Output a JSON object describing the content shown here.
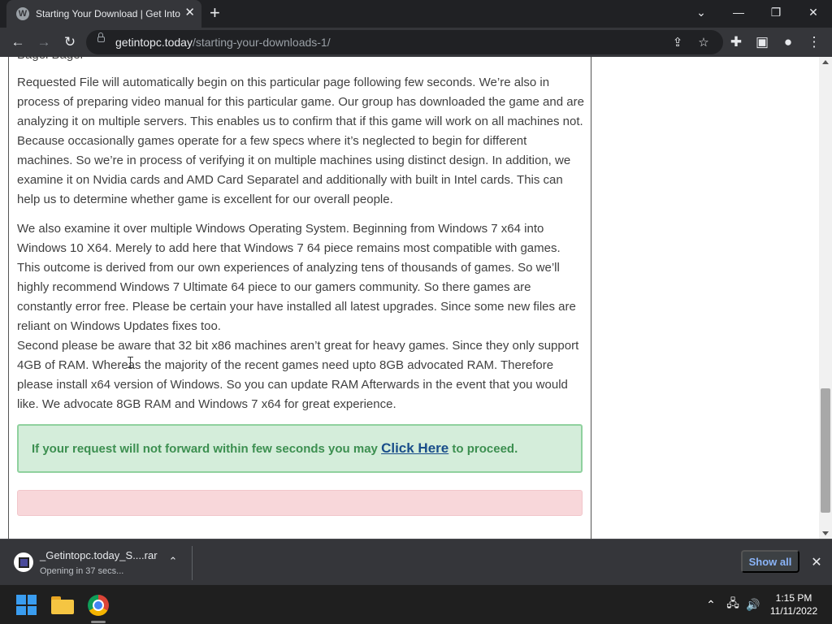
{
  "tab": {
    "favicon": "W",
    "title": "Starting Your Download | Get Into PC",
    "close_glyph": "✕",
    "new_tab_glyph": "+"
  },
  "window_controls": {
    "tab_search_glyph": "⌄",
    "minimize_glyph": "—",
    "restore_glyph": "❐",
    "close_glyph": "✕"
  },
  "toolbar": {
    "back_glyph": "←",
    "forward_glyph": "→",
    "reload_glyph": "↻",
    "url_domain": "getintopc.today",
    "url_path": "/starting-your-downloads-1/",
    "share_glyph": "⇪",
    "bookmark_glyph": "☆",
    "extensions_glyph": "✚",
    "sidepanel_glyph": "▣",
    "profile_glyph": "●",
    "menu_glyph": "⋮"
  },
  "page": {
    "cut_line": "Bagel Bagel",
    "paragraph1": "Requested File will automatically begin on this particular page following few seconds. We’re also in process of preparing video manual for this particular game. Our group has downloaded the game and are analyzing it on multiple servers. This enables us to confirm that if this game will work on all machines not. Because occasionally games operate for a few specs where it’s neglected to begin for different machines. So we’re in process of verifying it on multiple machines using distinct design. In addition, we examine it on Nvidia cards and AMD Card Separatel and additionally with built in Intel cards. This can help us to determine whether game is excellent for our overall people.",
    "paragraph2": "We also examine it over multiple Windows Operating System. Beginning from Windows 7 x64 into Windows 10 X64. Merely to add here that Windows 7 64 piece remains most compatible with games. This outcome is derived from our own experiences of analyzing tens of thousands of games. So we’ll highly recommend Windows 7 Ultimate 64 piece to our gamers community. So there games are constantly error free. Please be certain your have installed all latest upgrades. Since some new files are reliant on Windows Updates fixes too.",
    "paragraph3": "Second please be aware that 32 bit x86 machines aren’t great for heavy games. Since they only support 4GB of RAM. Whereas the majority of the recent games need upto 8GB advocated RAM. Therefore please install x64 version of Windows. So you can update RAM Afterwards in the event that you would like. We advocate 8GB RAM and Windows 7 x64 for great experience.",
    "notice_before": "If your request will not forward within few seconds you may ",
    "notice_link": "Click Here",
    "notice_after": " to proceed."
  },
  "download_bar": {
    "file_name": "_Getintopc.today_S....rar",
    "status": "Opening in 37 secs...",
    "chevron_glyph": "⌃",
    "show_all_label": "Show all",
    "close_glyph": "✕"
  },
  "taskbar": {
    "tray_chevron_glyph": "⌃",
    "network_glyph": "🖧",
    "volume_glyph": "🔊",
    "time": "1:15 PM",
    "date": "11/11/2022"
  },
  "colors": {
    "accent_link": "#8ab4f8",
    "notice_bg": "#d4edda",
    "notice_text": "#3c8f50",
    "error_bg": "#f8d7da"
  }
}
